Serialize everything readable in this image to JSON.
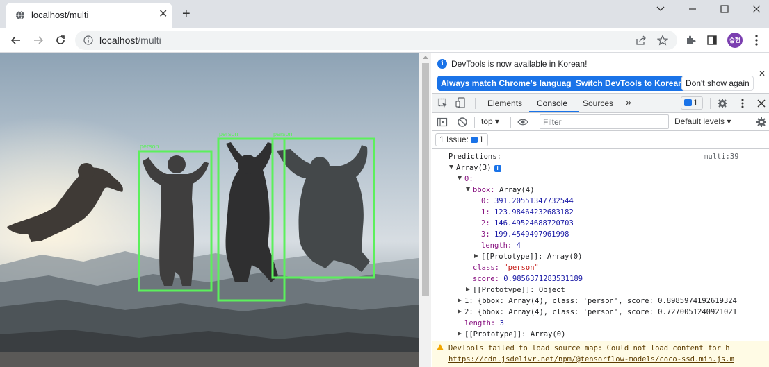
{
  "browser": {
    "tab_title": "localhost/multi",
    "url_host": "localhost",
    "url_path": "/multi",
    "avatar_text": "승현"
  },
  "detections": {
    "label_1": "person",
    "label_2": "person",
    "label_3": "person",
    "box_color": "#5cf05c"
  },
  "devtools": {
    "infobar_message": "DevTools is now available in Korean!",
    "btn_match_language": "Always match Chrome's language",
    "btn_switch_korean": "Switch DevTools to Korean",
    "btn_dont_show": "Don't show again",
    "tabs": {
      "elements": "Elements",
      "console": "Console",
      "sources": "Sources",
      "more": "»"
    },
    "message_count": "1",
    "context": "top",
    "filter_placeholder": "Filter",
    "levels": "Default levels",
    "issues_label": "1 Issue:",
    "issues_count": "1"
  },
  "console": {
    "l01_text": "Predictions:",
    "l01_src": "multi:39",
    "l02_text": "Array(3)",
    "l02_badge": "i",
    "l03_key": "0:",
    "l04_key": "bbox:",
    "l04_val": "Array(4)",
    "l05_key": "0:",
    "l05_val": "391.20551347732544",
    "l06_key": "1:",
    "l06_val": "123.98464232683182",
    "l07_key": "2:",
    "l07_val": "146.49524688720703",
    "l08_key": "3:",
    "l08_val": "199.4549497961998",
    "l09_key": "length:",
    "l09_val": "4",
    "l10_text": "[[Prototype]]: Array(0)",
    "l11_key": "class:",
    "l11_val": "\"person\"",
    "l12_key": "score:",
    "l12_val": "0.9856371283531189",
    "l13_text": "[[Prototype]]: Object",
    "l14_text": "1: {bbox: Array(4), class: 'person', score: 0.8985974192619324",
    "l15_text": "2: {bbox: Array(4), class: 'person', score: 0.7270051240921021",
    "l16_key": "length:",
    "l16_val": "3",
    "l17_text": "[[Prototype]]: Array(0)",
    "warning": "DevTools failed to load source map: Could not load content for h",
    "warning_link": "https://cdn.jsdelivr.net/npm/@tensorflow-models/coco-ssd.min.js.m"
  }
}
